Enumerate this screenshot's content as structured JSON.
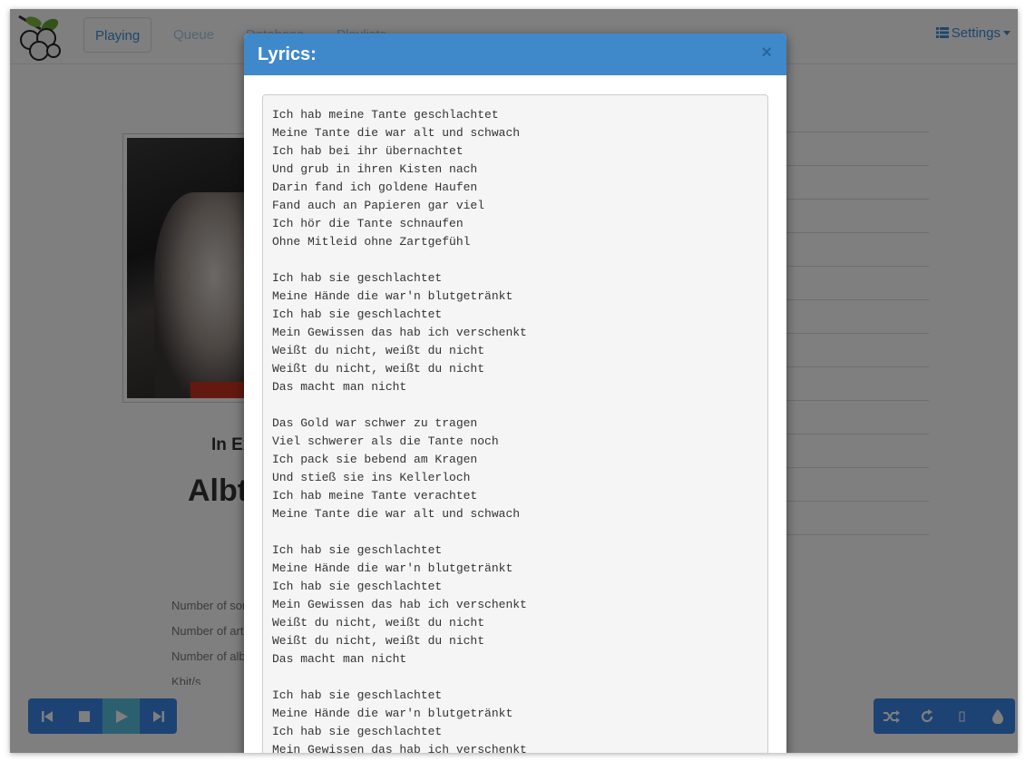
{
  "nav": {
    "tabs": [
      "Playing",
      "Queue",
      "Database",
      "Playlists"
    ],
    "settings_label": "Settings"
  },
  "background": {
    "artist": "In Extremo",
    "album": "Albtraum",
    "stats": [
      "Number of songs",
      "Number of artists",
      "Number of albums",
      "Kbit/s"
    ]
  },
  "modal": {
    "title": "Lyrics:",
    "close": "×",
    "lyrics": "Ich hab meine Tante geschlachtet\nMeine Tante die war alt und schwach\nIch hab bei ihr übernachtet\nUnd grub in ihren Kisten nach\nDarin fand ich goldene Haufen\nFand auch an Papieren gar viel\nIch hör die Tante schnaufen\nOhne Mitleid ohne Zartgefühl\n\nIch hab sie geschlachtet\nMeine Hände die war'n blutgetränkt\nIch hab sie geschlachtet\nMein Gewissen das hab ich verschenkt\nWeißt du nicht, weißt du nicht\nWeißt du nicht, weißt du nicht\nDas macht man nicht\n\nDas Gold war schwer zu tragen\nViel schwerer als die Tante noch\nIch pack sie bebend am Kragen\nUnd stieß sie ins Kellerloch\nIch hab meine Tante verachtet\nMeine Tante die war alt und schwach\n\nIch hab sie geschlachtet\nMeine Hände die war'n blutgetränkt\nIch hab sie geschlachtet\nMein Gewissen das hab ich verschenkt\nWeißt du nicht, weißt du nicht\nWeißt du nicht, weißt du nicht\nDas macht man nicht\n\nIch hab sie geschlachtet\nMeine Hände die war'n blutgetränkt\nIch hab sie geschlachtet\nMein Gewissen das hab ich verschenkt"
  },
  "player": {
    "left_icons": [
      "skip-back-icon",
      "stop-icon",
      "play-icon",
      "skip-forward-icon"
    ],
    "right_icons": [
      "shuffle-icon",
      "repeat-icon",
      "single-icon",
      "consume-icon"
    ]
  },
  "colors": {
    "accent": "#3a86e8",
    "modal_header": "#3f89cb",
    "active_control": "#5bc0de"
  }
}
